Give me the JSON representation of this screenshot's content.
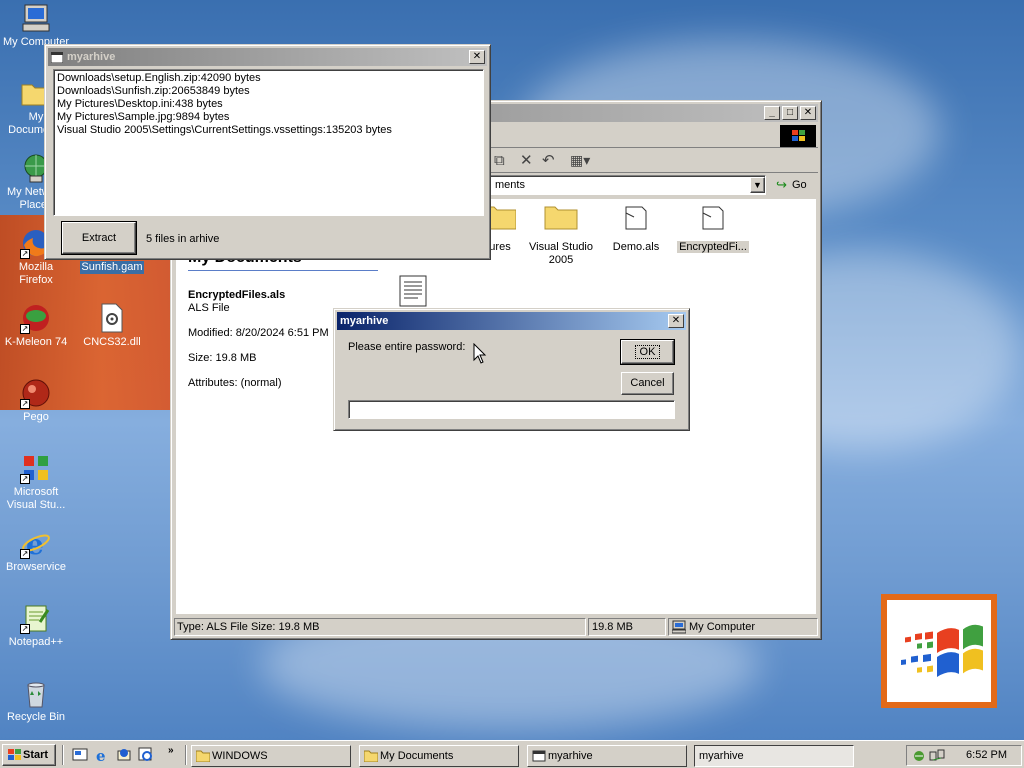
{
  "desktop": {
    "icons": [
      {
        "label": "My Computer"
      },
      {
        "label": "My Documents"
      },
      {
        "label": "My Network Places"
      },
      {
        "label": "Mozilla Firefox"
      },
      {
        "label": "Sunfish.gam"
      },
      {
        "label": "K-Meleon 74"
      },
      {
        "label": "CNCS32.dll"
      },
      {
        "label": "Pego"
      },
      {
        "label": "Microsoft Visual Stu..."
      },
      {
        "label": "Browservice"
      },
      {
        "label": "Notepad++"
      },
      {
        "label": "Recycle Bin"
      }
    ]
  },
  "archive_window": {
    "title": "myarhive",
    "files": [
      "Downloads\\setup.English.zip:42090 bytes",
      "Downloads\\Sunfish.zip:20653849 bytes",
      "My Pictures\\Desktop.ini:438 bytes",
      "My Pictures\\Sample.jpg:9894 bytes",
      "Visual Studio 2005\\Settings\\CurrentSettings.vssettings:135203 bytes"
    ],
    "extract_label": "Extract",
    "count_text": "5 files in arhive"
  },
  "explorer": {
    "address_text": "ments",
    "go_label": "Go",
    "folder_heading": "My Documents",
    "selected_name": "EncryptedFiles.als",
    "selected_type": "ALS File",
    "modified": "Modified: 8/20/2024 6:51 PM",
    "size": "Size: 19.8 MB",
    "attributes": "Attributes: (normal)",
    "items": [
      {
        "label": "ures"
      },
      {
        "label": "Visual Studio 2005"
      },
      {
        "label": "Demo.als"
      },
      {
        "label": "EncryptedFi..."
      }
    ],
    "status_left": "Type: ALS File Size: 19.8 MB",
    "status_size": "19.8 MB",
    "status_zone": "My Computer"
  },
  "password_dialog": {
    "title": "myarhive",
    "prompt": "Please entire password:",
    "ok_label": "OK",
    "cancel_label": "Cancel",
    "input_value": ""
  },
  "taskbar": {
    "start_label": "Start",
    "tasks": [
      {
        "label": "WINDOWS"
      },
      {
        "label": "My Documents"
      },
      {
        "label": "myarhive"
      },
      {
        "label": "myarhive"
      }
    ],
    "clock": "6:52 PM"
  },
  "colors": {
    "title_active": "#0a246a",
    "title_inactive": "#808080",
    "face": "#d4d0c8",
    "desktop": "#3a6ea5"
  }
}
